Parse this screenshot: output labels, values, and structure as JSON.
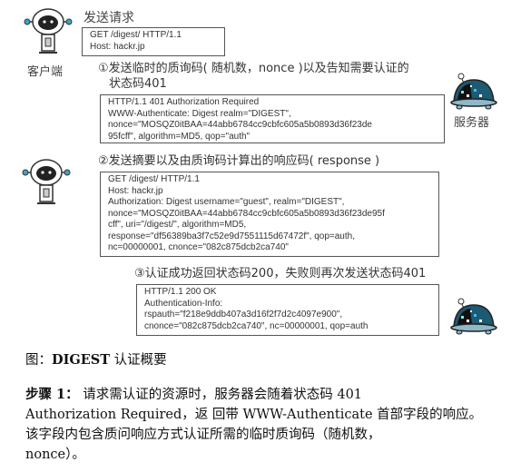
{
  "diagram": {
    "send_request_label": "发送请求",
    "client_label": "客户端",
    "server_label": "服务器",
    "request1": [
      "GET /digest/ HTTP/1.1",
      "Host: hackr.jp"
    ],
    "step1": [
      "①发送临时的质询码( 随机数，nonce )以及告知需要认证的",
      "状态码401"
    ],
    "response1": [
      "HTTP/1.1 401 Authorization Required",
      "WWW-Authenticate: Digest realm=\"DIGEST\",",
      "nonce=\"MOSQZ0itBAA=44abb6784cc9cbfc605a5b0893d36f23de",
      "95fcff\", algorithm=MD5, qop=\"auth\""
    ],
    "step2": "②发送摘要以及由质询码计算出的响应码( response )",
    "request2": [
      "GET /digest/ HTTP/1.1",
      "Host: hackr.jp",
      "Authorization: Digest username=\"guest\", realm=\"DIGEST\",",
      "nonce=\"MOSQZ0itBAA=44abb6784cc9cbfc605a5b0893d36f23de95f",
      "cff\", uri=\"/digest/\", algorithm=MD5,",
      "response=\"df56389ba3f7c52e9d7551115d67472f\", qop=auth,",
      "nc=00000001, cnonce=\"082c875dcb2ca740\""
    ],
    "step3": "③认证成功返回状态码200，失败则再次发送状态码401",
    "response2": [
      "HTTP/1.1 200 OK",
      "Authentication-Info:",
      "rspauth=\"f218e9ddb407a3d16f2f7d2c4097e900\",",
      "cnonce=\"082c875dcb2ca740\", nc=00000001, qop=auth"
    ]
  },
  "caption": {
    "prefix": "图：",
    "bold": "DIGEST",
    "suffix": " 认证概要"
  },
  "body": {
    "step_label": "步骤 1：",
    "text_line1": " 请求需认证的资源时，服务器会随着状态码 401",
    "text_line2": "Authorization Required，返 回带 WWW-Authenticate 首部字段的响应。",
    "text_line3": "该字段内包含质问响应方式认证所需的临时质询码（随机数，",
    "text_line4": "nonce）。"
  }
}
